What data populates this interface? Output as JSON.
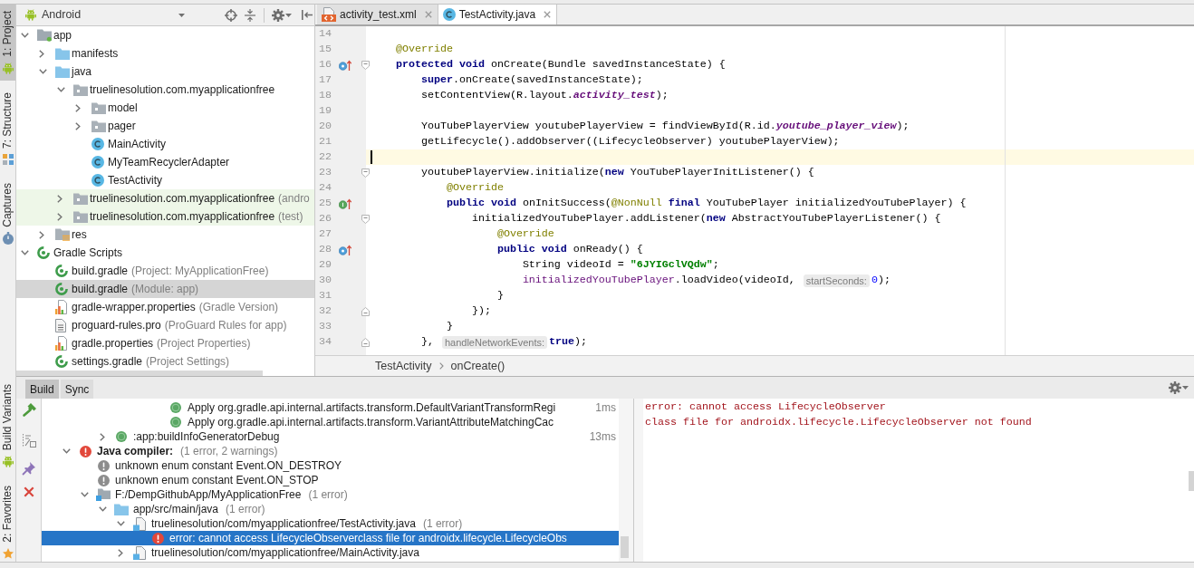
{
  "left_toolbar": {
    "top": [
      {
        "label": "1: Project",
        "kind": "project",
        "selected": true
      },
      {
        "label": "7: Structure",
        "kind": "structure",
        "selected": false
      },
      {
        "label": "Captures",
        "kind": "captures",
        "selected": false
      }
    ],
    "bottom": [
      {
        "label": "Build Variants",
        "kind": "build_variants",
        "selected": false
      },
      {
        "label": "2: Favorites",
        "kind": "favorites",
        "selected": false
      }
    ]
  },
  "project_panel": {
    "view": "Android",
    "tree": [
      {
        "label": "app",
        "kind": "module",
        "expanded": true,
        "selected": false,
        "children": [
          {
            "label": "manifests",
            "kind": "folder",
            "expanded": false,
            "selected": false
          },
          {
            "label": "java",
            "kind": "folder",
            "expanded": true,
            "selected": false,
            "children": [
              {
                "label": "truelinesolution.com.myapplicationfree",
                "kind": "package",
                "expanded": true,
                "selected": false,
                "test_source": false,
                "children": [
                  {
                    "label": "model",
                    "kind": "package",
                    "expanded": false,
                    "selected": false
                  },
                  {
                    "label": "pager",
                    "kind": "package",
                    "expanded": false,
                    "selected": false
                  },
                  {
                    "label": "MainActivity",
                    "kind": "class",
                    "selected": false
                  },
                  {
                    "label": "MyTeamRecyclerAdapter",
                    "kind": "class",
                    "selected": false
                  },
                  {
                    "label": "TestActivity",
                    "kind": "class",
                    "selected": false
                  }
                ]
              },
              {
                "label": "truelinesolution.com.myapplicationfree",
                "note": "(andro",
                "kind": "package",
                "expanded": false,
                "selected": false,
                "test_source": true
              },
              {
                "label": "truelinesolution.com.myapplicationfree",
                "note": "(test)",
                "kind": "package",
                "expanded": false,
                "selected": false,
                "test_source": true
              }
            ]
          },
          {
            "label": "res",
            "kind": "res",
            "expanded": false,
            "selected": false
          }
        ]
      },
      {
        "label": "Gradle Scripts",
        "kind": "gradle",
        "expanded": true,
        "selected": false,
        "children": [
          {
            "label": "build.gradle",
            "note": "(Project: MyApplicationFree)",
            "kind": "gradle",
            "selected": false
          },
          {
            "label": "build.gradle",
            "note": "(Module: app)",
            "kind": "gradle",
            "selected": true
          },
          {
            "label": "gradle-wrapper.properties",
            "note": "(Gradle Version)",
            "kind": "properties",
            "selected": false
          },
          {
            "label": "proguard-rules.pro",
            "note": "(ProGuard Rules for app)",
            "kind": "text",
            "selected": false
          },
          {
            "label": "gradle.properties",
            "note": "(Project Properties)",
            "kind": "properties",
            "selected": false
          },
          {
            "label": "settings.gradle",
            "note": "(Project Settings)",
            "kind": "gradle",
            "selected": false
          }
        ]
      }
    ]
  },
  "editor": {
    "tabs": [
      {
        "label": "activity_test.xml",
        "kind": "xml",
        "selected": false
      },
      {
        "label": "TestActivity.java",
        "kind": "class",
        "selected": true
      }
    ],
    "lines": [
      {
        "number": "14",
        "current": false
      },
      {
        "number": "15",
        "current": false,
        "segments": [
          {
            "kind": "annotation",
            "text": "    @Override"
          }
        ]
      },
      {
        "number": "16",
        "current": false,
        "marker": {
          "kind": "override"
        },
        "fold": {
          "kind": "start"
        },
        "segments": [
          {
            "kind": "keyword",
            "text": "    protected void"
          },
          {
            "kind": "plain",
            "text": " onCreate(Bundle savedInstanceState) {"
          }
        ]
      },
      {
        "number": "17",
        "current": false,
        "segments": [
          {
            "kind": "keyword",
            "text": "        super"
          },
          {
            "kind": "plain",
            "text": ".onCreate(savedInstanceState);"
          }
        ]
      },
      {
        "number": "18",
        "current": false,
        "segments": [
          {
            "kind": "plain",
            "text": "        setContentView(R.layout."
          },
          {
            "kind": "field",
            "text": "activity_test"
          },
          {
            "kind": "plain",
            "text": ");"
          }
        ]
      },
      {
        "number": "19",
        "current": false
      },
      {
        "number": "20",
        "current": false,
        "segments": [
          {
            "kind": "plain",
            "text": "        YouTubePlayerView youtubePlayerView = findViewById(R.id."
          },
          {
            "kind": "field",
            "text": "youtube_player_view"
          },
          {
            "kind": "plain",
            "text": ");"
          }
        ]
      },
      {
        "number": "21",
        "current": false,
        "segments": [
          {
            "kind": "plain",
            "text": "        getLifecycle().addObserver((LifecycleObserver) youtubePlayerView);"
          }
        ]
      },
      {
        "number": "22",
        "current": true
      },
      {
        "number": "23",
        "current": false,
        "fold": {
          "kind": "start"
        },
        "segments": [
          {
            "kind": "plain",
            "text": "        youtubePlayerView.initialize("
          },
          {
            "kind": "keyword",
            "text": "new"
          },
          {
            "kind": "plain",
            "text": " YouTubePlayerInitListener() {"
          }
        ]
      },
      {
        "number": "24",
        "current": false,
        "segments": [
          {
            "kind": "annotation",
            "text": "            @Override"
          }
        ]
      },
      {
        "number": "25",
        "current": false,
        "marker": {
          "kind": "implements"
        },
        "segments": [
          {
            "kind": "keyword",
            "text": "            public void"
          },
          {
            "kind": "plain",
            "text": " onInitSuccess("
          },
          {
            "kind": "annotation",
            "text": "@NonNull"
          },
          {
            "kind": "keyword",
            "text": " final"
          },
          {
            "kind": "plain",
            "text": " YouTubePlayer initializedYouTubePlayer) {"
          }
        ]
      },
      {
        "number": "26",
        "current": false,
        "fold": {
          "kind": "start"
        },
        "segments": [
          {
            "kind": "plain",
            "text": "                initializedYouTubePlayer.addListener("
          },
          {
            "kind": "keyword",
            "text": "new"
          },
          {
            "kind": "plain",
            "text": " AbstractYouTubePlayerListener() {"
          }
        ]
      },
      {
        "number": "27",
        "current": false,
        "segments": [
          {
            "kind": "annotation",
            "text": "                    @Override"
          }
        ]
      },
      {
        "number": "28",
        "current": false,
        "marker": {
          "kind": "override"
        },
        "segments": [
          {
            "kind": "keyword",
            "text": "                    public void"
          },
          {
            "kind": "plain",
            "text": " onReady() {"
          }
        ]
      },
      {
        "number": "29",
        "current": false,
        "segments": [
          {
            "kind": "plain",
            "text": "                        String videoId = "
          },
          {
            "kind": "string",
            "text": "\"6JYIGclVQdw\""
          },
          {
            "kind": "plain",
            "text": ";"
          }
        ]
      },
      {
        "number": "30",
        "current": false,
        "segments": [
          {
            "kind": "captured",
            "text": "                        initializedYouTubePlayer"
          },
          {
            "kind": "plain",
            "text": ".loadVideo(videoId, "
          },
          {
            "kind": "hint",
            "text": "startSeconds:"
          },
          {
            "kind": "number",
            "text": "0"
          },
          {
            "kind": "plain",
            "text": ");"
          }
        ]
      },
      {
        "number": "31",
        "current": false,
        "segments": [
          {
            "kind": "plain",
            "text": "                    }"
          }
        ]
      },
      {
        "number": "32",
        "current": false,
        "fold": {
          "kind": "end"
        },
        "segments": [
          {
            "kind": "plain",
            "text": "                });"
          }
        ]
      },
      {
        "number": "33",
        "current": false,
        "segments": [
          {
            "kind": "plain",
            "text": "            }"
          }
        ]
      },
      {
        "number": "34",
        "current": false,
        "fold": {
          "kind": "end"
        },
        "segments": [
          {
            "kind": "plain",
            "text": "        }, "
          },
          {
            "kind": "hint",
            "text": "handleNetworkEvents:"
          },
          {
            "kind": "keyword",
            "text": "true"
          },
          {
            "kind": "plain",
            "text": ");"
          }
        ]
      }
    ],
    "breadcrumb": [
      "TestActivity",
      "onCreate()"
    ]
  },
  "build_panel": {
    "tabs": [
      {
        "label": "Build",
        "selected": true
      },
      {
        "label": "Sync",
        "selected": false
      }
    ],
    "tree": [
      {
        "children": [
          {
            "children": [
              {
                "children": [
                  {
                    "children": [
                      {
                        "children": [
                          {
                            "label": "Apply org.gradle.api.internal.artifacts.transform.DefaultVariantTransformRegi",
                            "kind": "ok",
                            "time": "1ms",
                            "selected": false
                          },
                          {
                            "label": "Apply org.gradle.api.internal.artifacts.transform.VariantAttributeMatchingCac",
                            "kind": "ok",
                            "selected": false
                          }
                        ]
                      }
                    ]
                  }
                ]
              },
              {
                "label": ":app:buildInfoGeneratorDebug",
                "kind": "ok",
                "time": "13ms",
                "expanded": false,
                "selected": false
              }
            ]
          }
        ]
      },
      {
        "label": "Java compiler:",
        "note": "(1 error, 2 warnings)",
        "kind": "compiler",
        "expanded": true,
        "selected": false,
        "children": [
          {
            "label": "unknown enum constant Event.ON_DESTROY",
            "kind": "warning",
            "selected": false
          },
          {
            "label": "unknown enum constant Event.ON_STOP",
            "kind": "warning",
            "selected": false
          },
          {
            "label": "F:/DempGithubApp/MyApplicationFree",
            "note": "(1 error)",
            "kind": "module",
            "expanded": true,
            "selected": false,
            "children": [
              {
                "label": "app/src/main/java",
                "note": "(1 error)",
                "kind": "folder",
                "expanded": true,
                "selected": false,
                "children": [
                  {
                    "label": "truelinesolution/com/myapplicationfree/TestActivity.java",
                    "note": "(1 error)",
                    "kind": "java",
                    "expanded": true,
                    "selected": false,
                    "children": [
                      {
                        "label": "error: cannot access LifecycleObserverclass file for androidx.lifecycle.LifecycleObs",
                        "kind": "error",
                        "selected": true
                      }
                    ]
                  },
                  {
                    "label": "truelinesolution/com/myapplicationfree/MainActivity.java",
                    "kind": "java",
                    "expanded": false,
                    "selected": false
                  }
                ]
              }
            ]
          }
        ]
      }
    ],
    "console": [
      "error: cannot access LifecycleObserver",
      "class file for androidx.lifecycle.LifecycleObserver not found"
    ]
  }
}
